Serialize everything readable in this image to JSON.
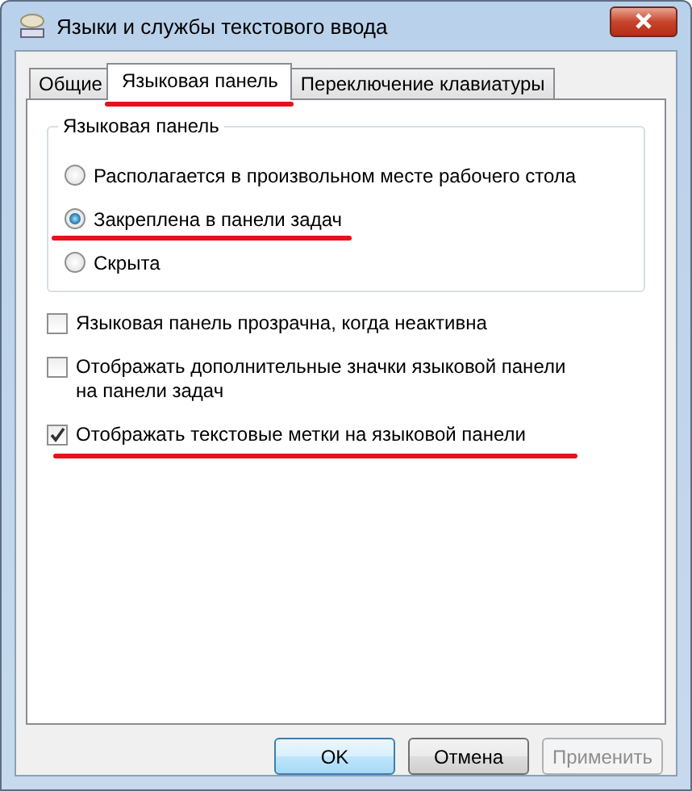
{
  "window": {
    "title": "Языки и службы текстового ввода"
  },
  "tabs": [
    {
      "label": "Общие",
      "selected": false,
      "underlined": false
    },
    {
      "label": "Языковая панель",
      "selected": true,
      "underlined": true
    },
    {
      "label": "Переключение клавиатуры",
      "selected": false,
      "underlined": false
    }
  ],
  "group": {
    "title": "Языковая панель",
    "options": [
      {
        "label": "Располагается в произвольном месте рабочего стола",
        "selected": false,
        "underlined": false
      },
      {
        "label": "Закреплена в панели задач",
        "selected": true,
        "underlined": true
      },
      {
        "label": "Скрыта",
        "selected": false,
        "underlined": false
      }
    ]
  },
  "checkboxes": [
    {
      "label": "Языковая панель прозрачна, когда неактивна",
      "checked": false,
      "underlined": false
    },
    {
      "label": "Отображать дополнительные значки языковой панели на панели задач",
      "checked": false,
      "underlined": false
    },
    {
      "label": "Отображать текстовые метки на языковой панели",
      "checked": true,
      "underlined": true
    }
  ],
  "buttons": [
    {
      "label": "OK",
      "kind": "default",
      "disabled": false
    },
    {
      "label": "Отмена",
      "kind": "normal",
      "disabled": false
    },
    {
      "label": "Применить",
      "kind": "normal",
      "disabled": true
    }
  ]
}
